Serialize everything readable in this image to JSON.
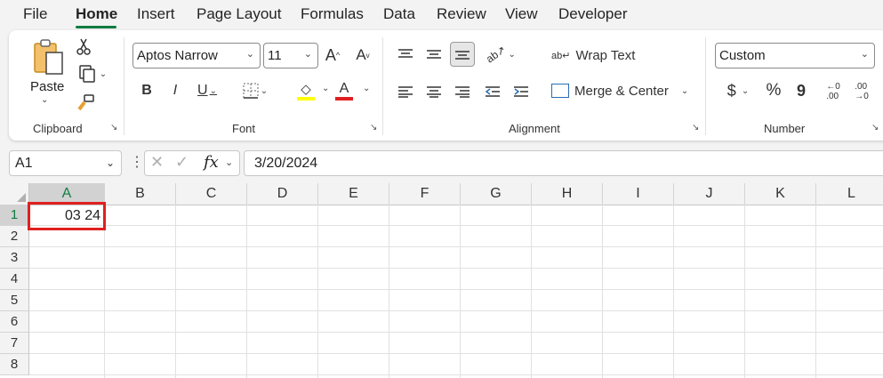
{
  "menu": {
    "items": [
      "File",
      "Home",
      "Insert",
      "Page Layout",
      "Formulas",
      "Data",
      "Review",
      "View",
      "Developer"
    ],
    "active": "Home"
  },
  "ribbon": {
    "clipboard": {
      "paste_label": "Paste",
      "group_label": "Clipboard"
    },
    "font": {
      "font_name": "Aptos Narrow",
      "font_size": "11",
      "group_label": "Font",
      "highlight_color": "#ffff00",
      "font_color": "#e02020"
    },
    "alignment": {
      "wrap_text": "Wrap Text",
      "merge_center": "Merge & Center",
      "group_label": "Alignment"
    },
    "number": {
      "format": "Custom",
      "currency": "$",
      "percent": "%",
      "comma": "9",
      "group_label": "Number"
    }
  },
  "formula_bar": {
    "name_box": "A1",
    "fx": "fx",
    "value": "3/20/2024"
  },
  "grid": {
    "columns": [
      "A",
      "B",
      "C",
      "D",
      "E",
      "F",
      "G",
      "H",
      "I",
      "J",
      "K",
      "L"
    ],
    "rows": [
      "1",
      "2",
      "3",
      "4",
      "5",
      "6",
      "7",
      "8"
    ],
    "selected_cell": "A1",
    "a1_display": "03 24"
  },
  "colors": {
    "accent": "#107c41",
    "highlight_box": "#e02020"
  }
}
